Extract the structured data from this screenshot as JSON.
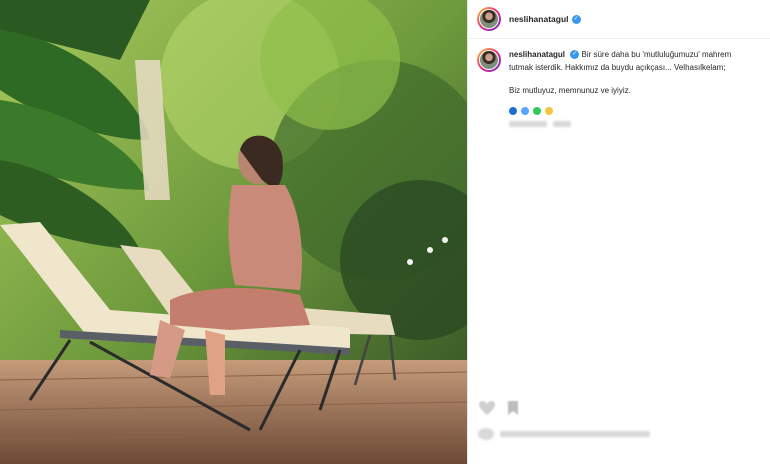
{
  "post": {
    "username": "neslihanatagul",
    "caption_line1": "Bir süre daha bu 'mutluluğumuzu' mahrem",
    "caption_line2": "tutmak isterdik. Hakkımız da buydu açıkçası... Velhasılkelam;",
    "caption_line3": "Biz mutluyuz, memnunuz ve iyiyiz."
  },
  "icons": {
    "verified": "✓",
    "emoji_colors": [
      "#1f6fd1",
      "#58a6ff",
      "#34c759",
      "#f5c542"
    ]
  },
  "colors": {
    "accent": "#3897f0"
  }
}
